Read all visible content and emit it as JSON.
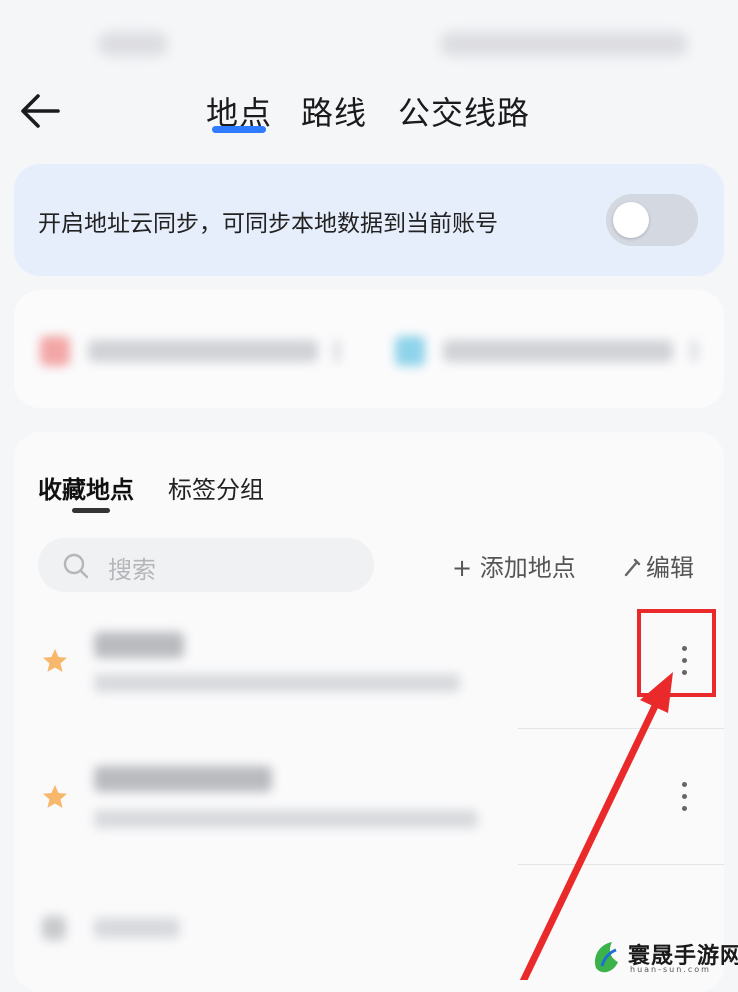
{
  "nav": {
    "tabs": [
      {
        "label": "地点",
        "active": true
      },
      {
        "label": "路线",
        "active": false
      },
      {
        "label": "公交线路",
        "active": false
      }
    ],
    "active_color": "#2f7bff"
  },
  "sync_banner": {
    "text": "开启地址云同步，可同步本地数据到当前账号",
    "toggle_on": false
  },
  "favorites": {
    "tabs": [
      {
        "label": "收藏地点",
        "active": true
      },
      {
        "label": "标签分组",
        "active": false
      }
    ],
    "search": {
      "placeholder": "搜索"
    },
    "add_label": "+ 添加地点",
    "edit_label": "编辑"
  },
  "colors": {
    "star": "#f6a23d",
    "annotation": "#ea2a2a",
    "toggle_off": "#d3d8e1"
  },
  "watermark": {
    "name": "寰晟手游网",
    "sub": "huan-sun.com"
  }
}
